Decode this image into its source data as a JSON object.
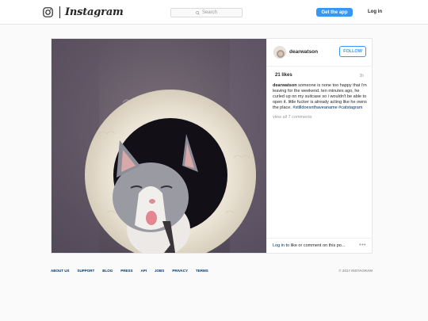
{
  "header": {
    "wordmark": "Instagram",
    "search_placeholder": "Search",
    "get_app_label": "Get the app",
    "login_label": "Log in"
  },
  "post": {
    "username": "dearwatson",
    "follow_label": "FOLLOW",
    "likes": "21 likes",
    "time_ago": "3h",
    "caption_user": "dearwatson",
    "caption_text": " someone is none too happy that i'm leaving for the weekend. ten minutes ago, he curled up on my suitcase so i wouldn't be able to open it. little fucker is already acting like he owns the place. ",
    "hashtags": "#stilldoesnthaveaname #catstagram",
    "view_comments": "view all 7 comments",
    "login_link": "Log in",
    "comment_prompt": " to like or comment on this po...",
    "more_icon": "•••"
  },
  "footer": {
    "links": [
      "About us",
      "Support",
      "Blog",
      "Press",
      "API",
      "Jobs",
      "Privacy",
      "Terms"
    ],
    "copyright": "© 2017 INSTAGRAM"
  },
  "colors": {
    "accent": "#3897f0",
    "link": "#003569",
    "muted": "#999999"
  },
  "icons": {
    "logo": "instagram-camera-icon",
    "search": "search-icon",
    "more": "more-dots-icon"
  }
}
